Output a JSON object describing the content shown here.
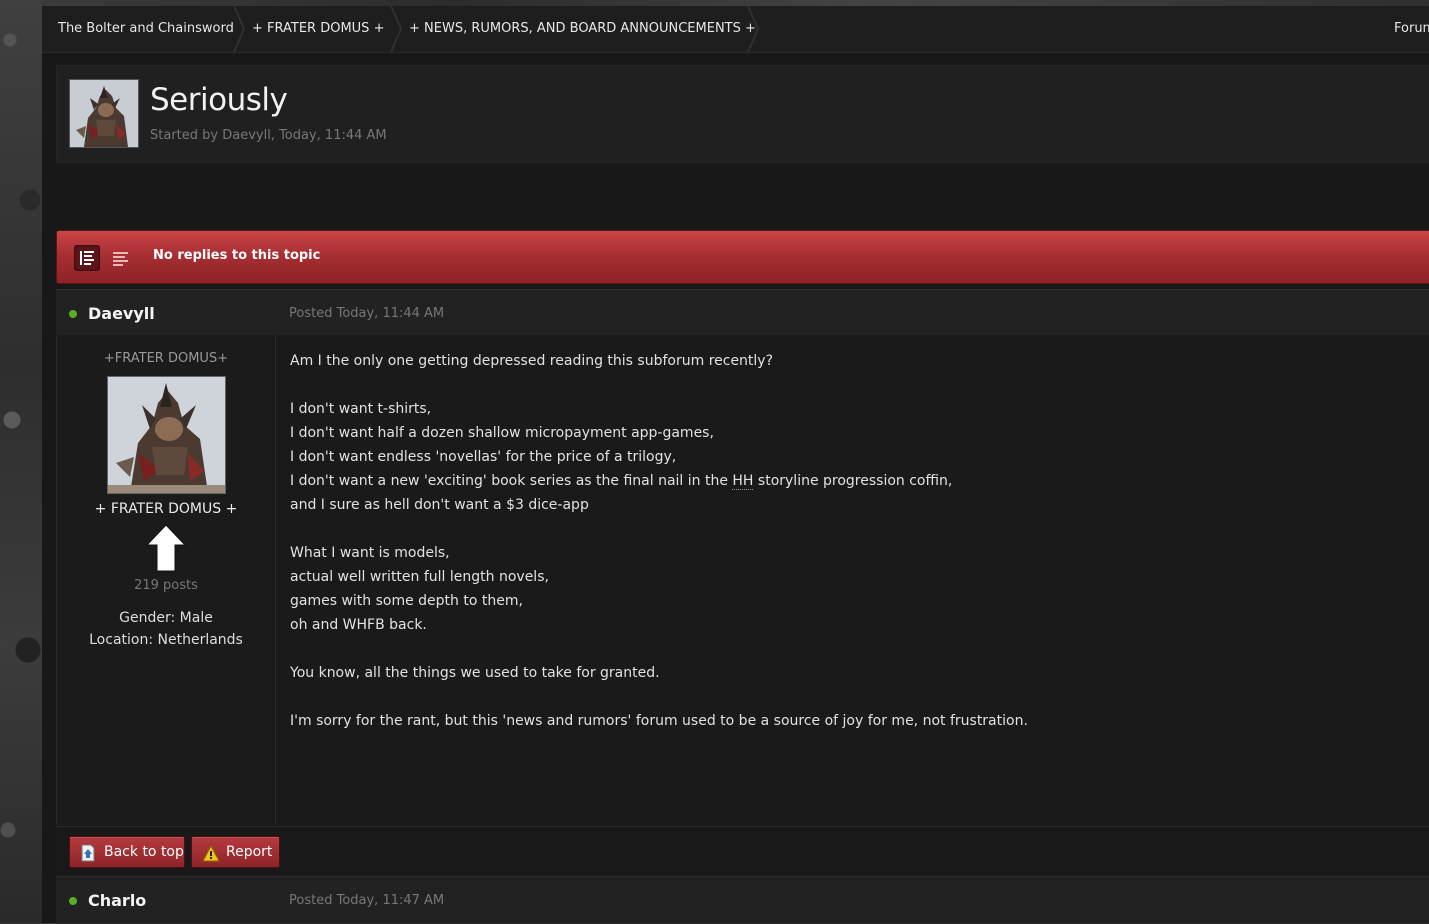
{
  "breadcrumb": {
    "items": [
      "The Bolter and Chainsword",
      "+ FRATER DOMUS +",
      "+ NEWS, RUMORS, AND BOARD ANNOUNCEMENTS +"
    ],
    "right_link": "Forum"
  },
  "topic": {
    "title": "Seriously",
    "meta": "Started by Daevyll, Today, 11:44 AM"
  },
  "reply_bar": {
    "label": "No replies to this topic",
    "view_modes": [
      "list-view-icon",
      "text-view-icon"
    ]
  },
  "posts": [
    {
      "author": "Daevyll",
      "online": true,
      "date": "Posted Today, 11:44 AM",
      "group_title": "+FRATER DOMUS+",
      "rank_title": "+ FRATER DOMUS +",
      "post_count": "219 posts",
      "gender": "Gender: Male",
      "location": "Location: Netherlands",
      "lines": [
        "Am I the only one getting depressed reading this subforum recently?",
        "",
        "I don't want t-shirts,",
        "I don't want half a dozen shallow micropayment app-games,",
        "I don't want endless 'novellas' for the price of a trilogy,",
        "I don't want a new 'exciting' book series as the final nail in the HH storyline progression coffin,",
        "and I sure as hell don't want a $3 dice-app",
        "",
        "What I want is models,",
        "actual well written full length novels,",
        "games with some depth to them,",
        "oh and WHFB back.",
        "",
        "You know, all the things we used to take for granted.",
        "",
        "I'm sorry for the rant, but this 'news and rumors' forum used to be a source of joy for me, not frustration."
      ]
    },
    {
      "author": "Charlo",
      "online": true,
      "date": "Posted Today, 11:47 AM"
    }
  ],
  "post_actions": {
    "back_to_top": "Back to top",
    "report": "Report"
  },
  "colors": {
    "accent_red": "#a82f33",
    "online_green": "#5cae2a",
    "background": "#181818"
  }
}
